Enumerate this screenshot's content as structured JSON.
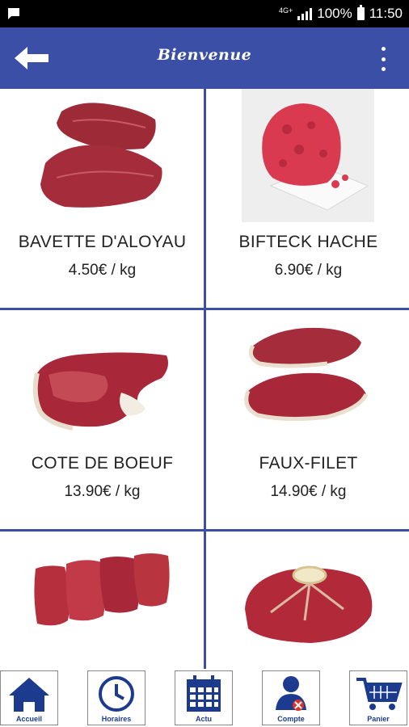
{
  "status_bar": {
    "network": "4G+",
    "battery": "100%",
    "time": "11:50",
    "notification_icon": "message-icon"
  },
  "app_bar": {
    "title": "Bienvenue",
    "back_icon": "arrow-left-icon",
    "menu_icon": "more-vert-icon",
    "background_color": "#3a4fa5"
  },
  "products": [
    {
      "name": "BAVETTE D'ALOYAU",
      "price": "4.50€ / kg"
    },
    {
      "name": "BIFTECK HACHE",
      "price": "6.90€ / kg"
    },
    {
      "name": "COTE DE BOEUF",
      "price": "13.90€ / kg"
    },
    {
      "name": "FAUX-FILET",
      "price": "14.90€ / kg"
    },
    {
      "name": "",
      "price": ""
    },
    {
      "name": "",
      "price": ""
    }
  ],
  "bottom_nav": [
    {
      "label": "Accueil",
      "icon": "home-icon"
    },
    {
      "label": "Horaires",
      "icon": "clock-icon"
    },
    {
      "label": "Actu",
      "icon": "calendar-icon"
    },
    {
      "label": "Compte",
      "icon": "account-icon"
    },
    {
      "label": "Panier",
      "icon": "cart-icon"
    }
  ],
  "colors": {
    "primary": "#3a4fa5",
    "nav_icon": "#1c3b8e",
    "meat": "#a8283a"
  }
}
